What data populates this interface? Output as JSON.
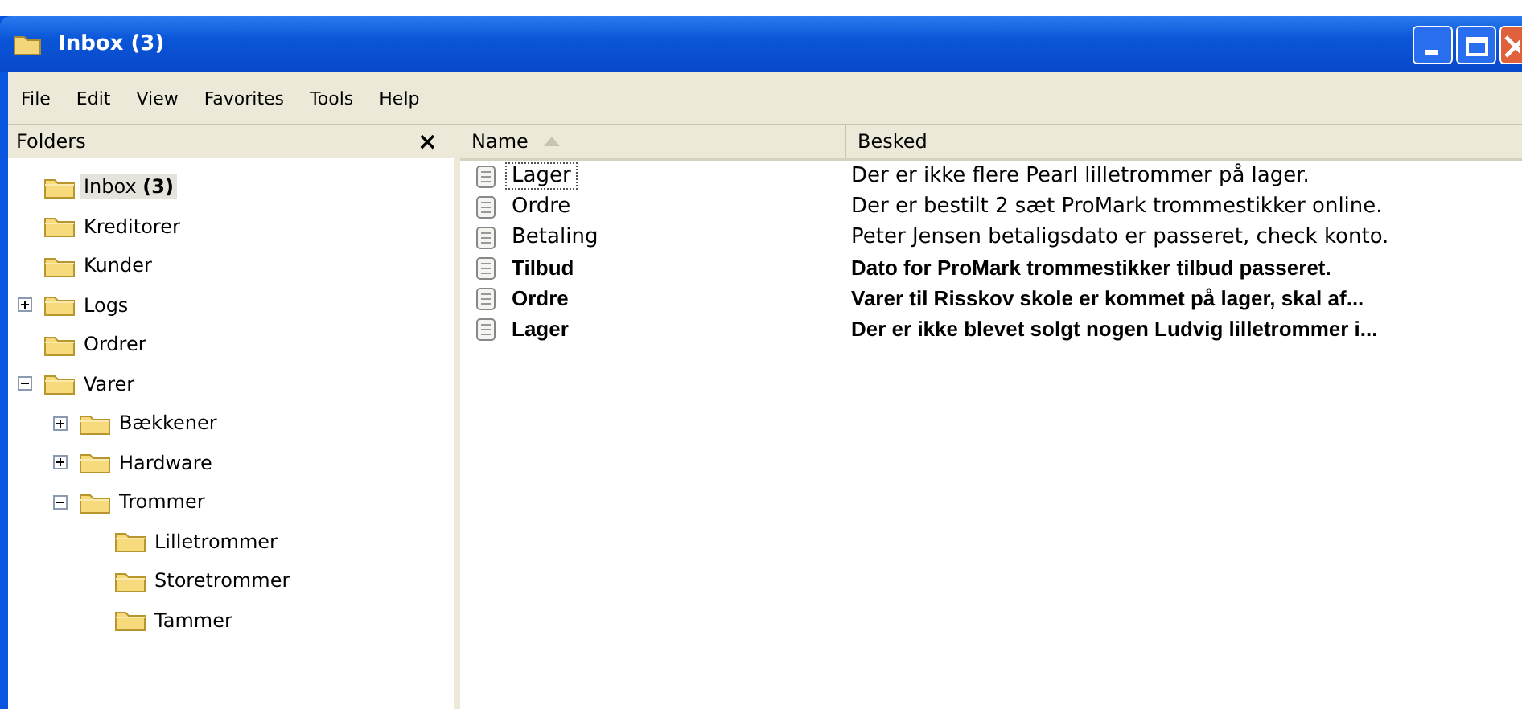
{
  "window": {
    "title": "Inbox (3)"
  },
  "menu": [
    "File",
    "Edit",
    "View",
    "Favorites",
    "Tools",
    "Help"
  ],
  "folders_pane": {
    "title": "Folders",
    "close": "×",
    "tree": [
      {
        "label": "Inbox **(3)**",
        "selected": true
      },
      {
        "label": "Kreditorer",
        "selected": false
      },
      {
        "label": "Kunder",
        "selected": false
      },
      {
        "label": "Logs",
        "selected": false,
        "expanded": false
      },
      {
        "label": "Ordrer",
        "selected": false
      },
      {
        "label": "Varer",
        "selected": false,
        "expanded": true,
        "children": [
          {
            "label": "Bækkener",
            "selected": false,
            "expanded": false
          },
          {
            "label": "Hardware",
            "selected": false,
            "expanded": false
          },
          {
            "label": "Trommer",
            "selected": false,
            "expanded": true,
            "children": [
              {
                "label": "Lilletrommer",
                "selected": false
              },
              {
                "label": "Storetrommer",
                "selected": false
              },
              {
                "label": "Tammer",
                "selected": false
              }
            ]
          }
        ]
      }
    ]
  },
  "table": {
    "columns": [
      "Name",
      "Besked"
    ],
    "rows": [
      {
        "name": "Lager",
        "message": "Der er ikke flere Pearl lilletrommer på lager.",
        "unread": false,
        "focused": true
      },
      {
        "name": "Ordre",
        "message": "Der er bestilt 2 sæt ProMark trommestikker online.",
        "unread": false,
        "focused": false
      },
      {
        "name": "Betaling",
        "message": "Peter Jensen betaligsdato er passeret, check konto.",
        "unread": false,
        "focused": false
      },
      {
        "name": "Tilbud",
        "message": "Dato for ProMark trommestikker tilbud passeret.",
        "unread": true,
        "focused": false
      },
      {
        "name": "Ordre",
        "message": "Varer til Risskov skole er kommet på lager, skal af...",
        "unread": true,
        "focused": false
      },
      {
        "name": "Lager",
        "message": "Der er ikke blevet solgt nogen Ludvig lilletrommer i...",
        "unread": true,
        "focused": false
      }
    ]
  }
}
